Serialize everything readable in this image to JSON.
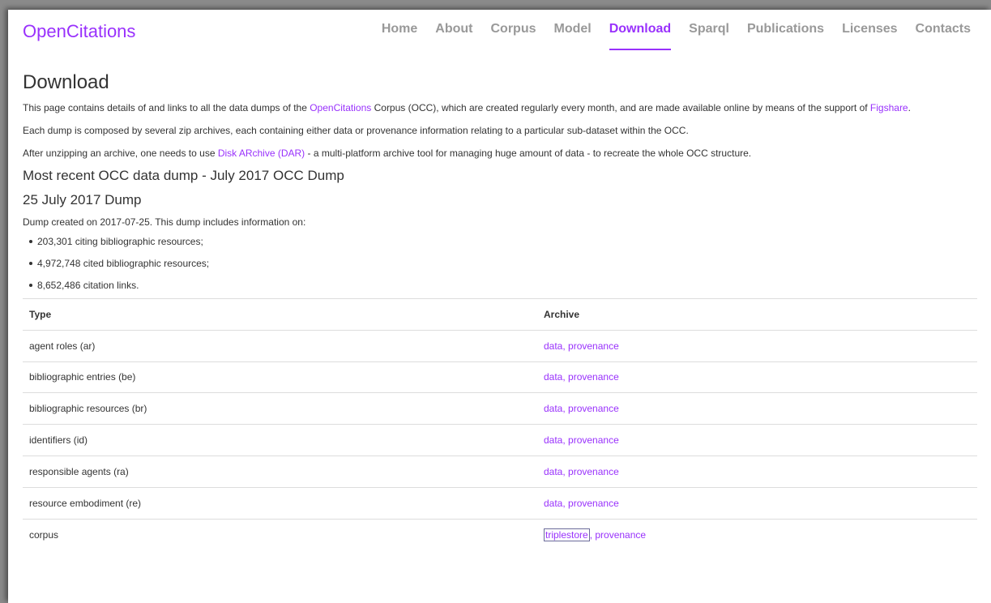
{
  "brand": {
    "part1": "Open",
    "part2": "Citations"
  },
  "nav": {
    "items": [
      "Home",
      "About",
      "Corpus",
      "Model",
      "Download",
      "Sparql",
      "Publications",
      "Licenses",
      "Contacts"
    ],
    "active": "Download"
  },
  "page": {
    "title": "Download",
    "intro": {
      "before": "This page contains details of and links to all the data dumps of the ",
      "link1": "OpenCitations",
      "middle": " Corpus (OCC), which are created regularly every month, and are made available online by means of the support of ",
      "link2": "Figshare",
      "after": "."
    },
    "para2": "Each dump is composed by several zip archives, each containing either data or provenance information relating to a particular sub-dataset within the OCC.",
    "para3": {
      "before": "After unzipping an archive, one needs to use ",
      "link": "Disk ARchive (DAR)",
      "after": " - a multi-platform archive tool for managing huge amount of data - to recreate the whole OCC structure."
    },
    "recent_heading": "Most recent OCC data dump - July 2017 OCC Dump",
    "dump_heading": "25 July 2017 Dump",
    "dump_intro": "Dump created on 2017-07-25. This dump includes information on:",
    "stats": [
      "203,301 citing bibliographic resources;",
      "4,972,748 cited bibliographic resources;",
      "8,652,486 citation links."
    ]
  },
  "table": {
    "headers": {
      "type": "Type",
      "archive": "Archive"
    },
    "rows": [
      {
        "type": "agent roles (ar)",
        "link1": "data",
        "sep": ", ",
        "link2": "provenance"
      },
      {
        "type": "bibliographic entries (be)",
        "link1": "data",
        "sep": ", ",
        "link2": "provenance"
      },
      {
        "type": "bibliographic resources (br)",
        "link1": "data",
        "sep": ", ",
        "link2": "provenance"
      },
      {
        "type": "identifiers (id)",
        "link1": "data",
        "sep": ", ",
        "link2": "provenance"
      },
      {
        "type": "responsible agents (ra)",
        "link1": "data",
        "sep": ", ",
        "link2": "provenance"
      },
      {
        "type": "resource embodiment (re)",
        "link1": "data",
        "sep": ", ",
        "link2": "provenance"
      },
      {
        "type": "corpus",
        "link1": "triplestore",
        "sep": ", ",
        "link2": "provenance"
      }
    ]
  },
  "colors": {
    "accent": "#9931fc",
    "text": "#333333",
    "nav_inactive": "#999999",
    "rule": "#dddddd"
  }
}
